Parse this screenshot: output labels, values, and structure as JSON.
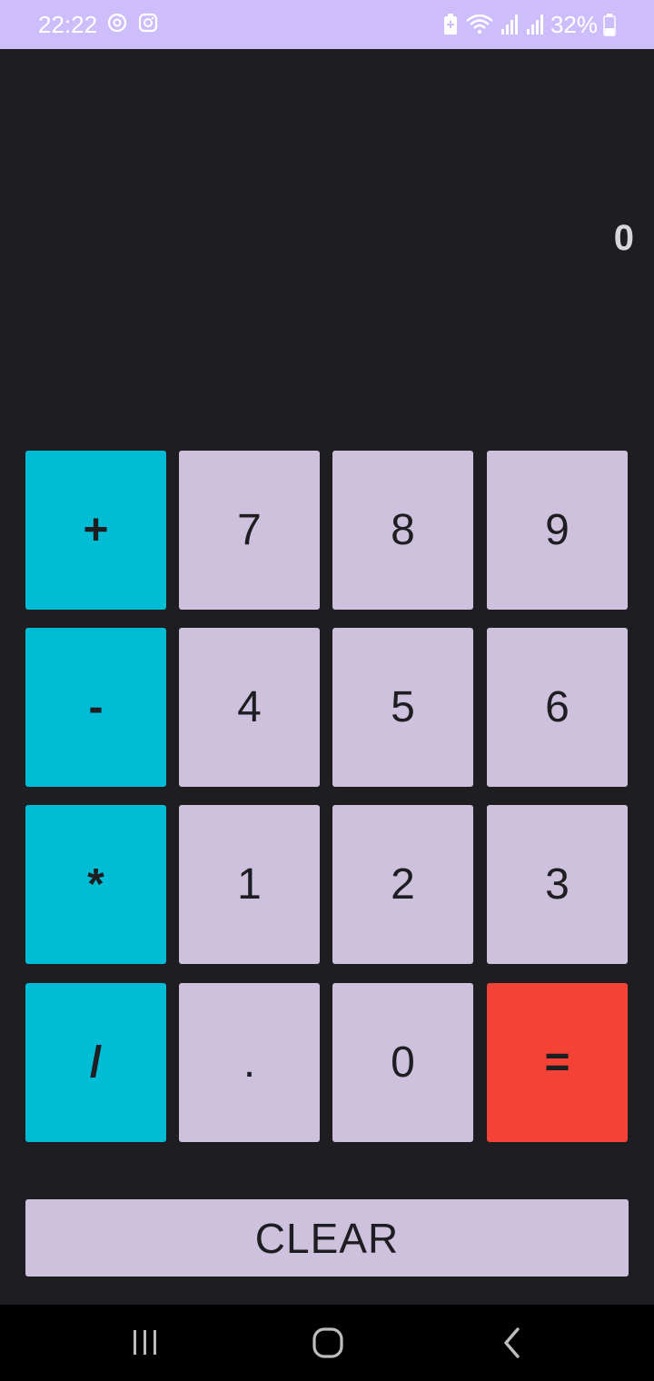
{
  "status_bar": {
    "time": "22:22",
    "battery_text": "32%",
    "left_icons": [
      "sync-icon",
      "instagram-icon"
    ],
    "right_icons": [
      "battery-saver-icon",
      "wifi-icon",
      "signal-icon",
      "signal-icon",
      "battery-icon"
    ]
  },
  "display": {
    "value": "0"
  },
  "keypad": {
    "rows": [
      [
        "+",
        "7",
        "8",
        "9"
      ],
      [
        "-",
        "4",
        "5",
        "6"
      ],
      [
        "*",
        "1",
        "2",
        "3"
      ],
      [
        "/",
        ".",
        "0",
        "="
      ]
    ]
  },
  "clear_label": "CLEAR",
  "nav": {
    "buttons": [
      "recent-apps-icon",
      "home-icon",
      "back-icon"
    ]
  },
  "colors": {
    "background": "#1e1d22",
    "status_bar": "#cebdfb",
    "operator": "#00bcd4",
    "digit": "#cdc1dd",
    "equals": "#f44336"
  }
}
